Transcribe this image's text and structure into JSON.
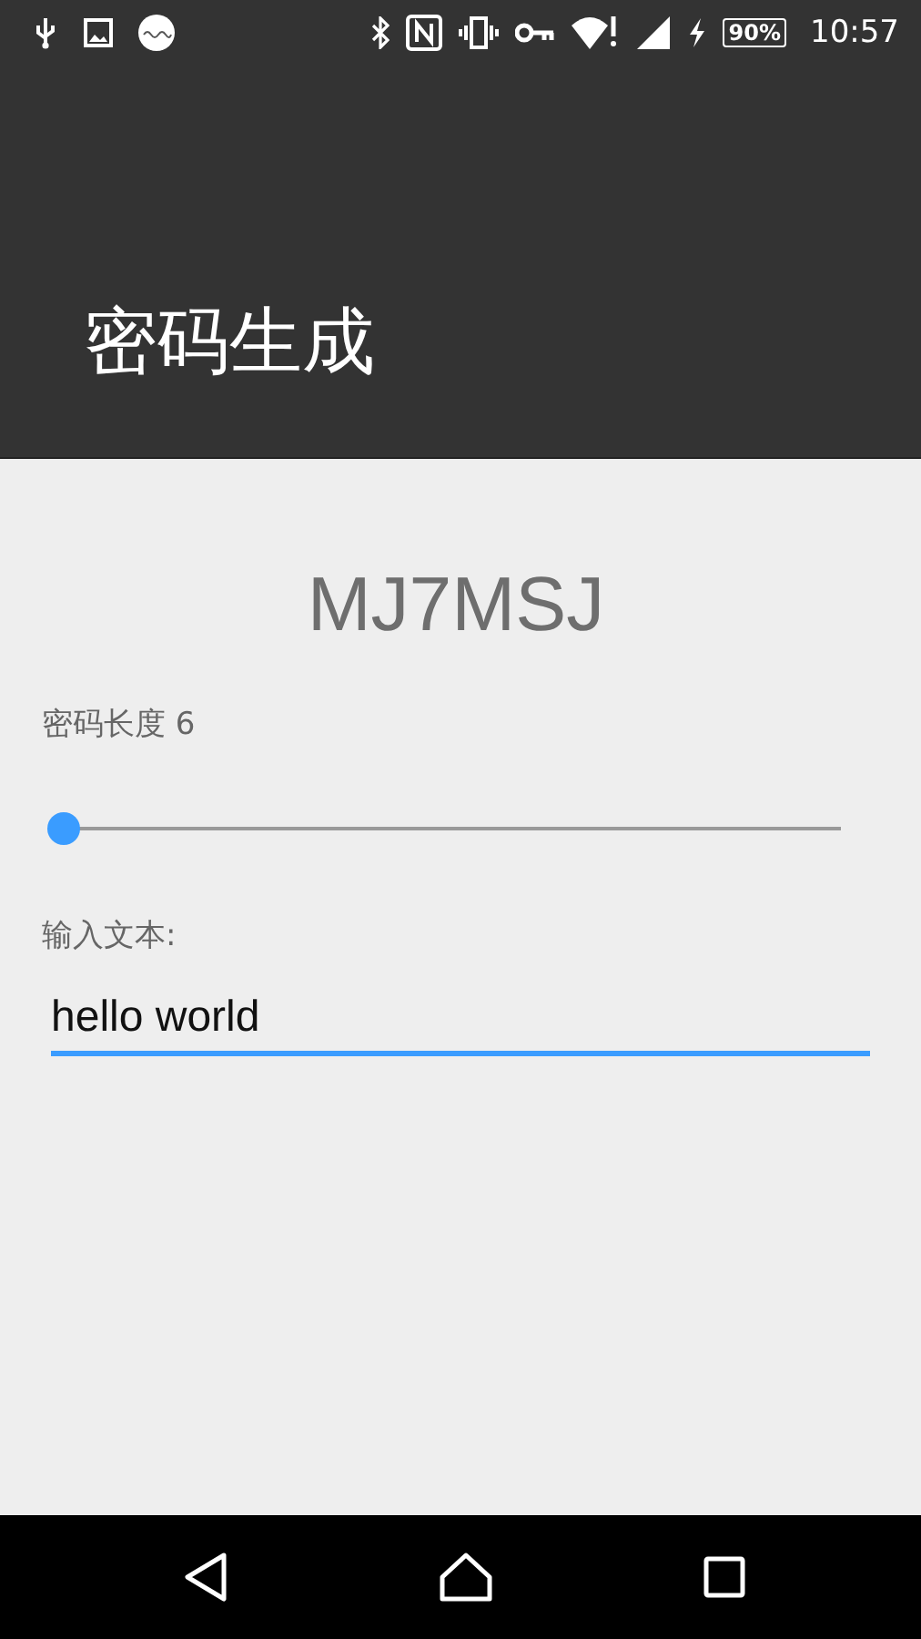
{
  "status_bar": {
    "battery": "90%",
    "time": "10:57"
  },
  "app_bar": {
    "title": "密码生成"
  },
  "password": "MJ7MSJ",
  "length_label": "密码长度 6",
  "slider": {
    "level": 0
  },
  "input": {
    "label": "输入文本:",
    "value": "hello world"
  }
}
